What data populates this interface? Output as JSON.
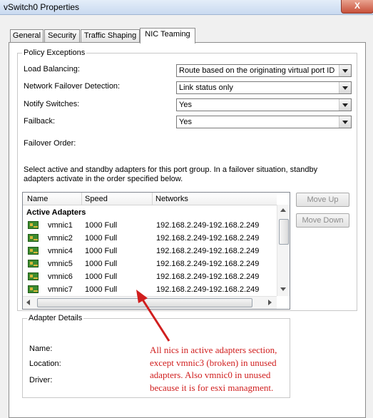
{
  "window": {
    "title": "vSwitch0 Properties",
    "close_label": "X"
  },
  "tabs": [
    "General",
    "Security",
    "Traffic Shaping",
    "NIC Teaming"
  ],
  "policy": {
    "legend": "Policy Exceptions",
    "rows": [
      {
        "label": "Load Balancing:",
        "value": "Route based on the originating virtual port ID"
      },
      {
        "label": "Network Failover Detection:",
        "value": "Link status only"
      },
      {
        "label": "Notify Switches:",
        "value": "Yes"
      },
      {
        "label": "Failback:",
        "value": "Yes"
      }
    ],
    "failover_order_label": "Failover Order:",
    "description": "Select active and standby adapters for this port group.  In a failover situation, standby adapters activate  in the order specified below."
  },
  "adapters": {
    "columns": [
      "Name",
      "Speed",
      "Networks"
    ],
    "group": "Active Adapters",
    "rows": [
      {
        "name": "vmnic1",
        "speed": "1000 Full",
        "networks": "192.168.2.249-192.168.2.249"
      },
      {
        "name": "vmnic2",
        "speed": "1000 Full",
        "networks": "192.168.2.249-192.168.2.249"
      },
      {
        "name": "vmnic4",
        "speed": "1000 Full",
        "networks": "192.168.2.249-192.168.2.249"
      },
      {
        "name": "vmnic5",
        "speed": "1000 Full",
        "networks": "192.168.2.249-192.168.2.249"
      },
      {
        "name": "vmnic6",
        "speed": "1000 Full",
        "networks": "192.168.2.249-192.168.2.249"
      },
      {
        "name": "vmnic7",
        "speed": "1000 Full",
        "networks": "192.168.2.249-192.168.2.249"
      }
    ]
  },
  "buttons": {
    "move_up": "Move Up",
    "move_down": "Move Down"
  },
  "details": {
    "legend": "Adapter Details",
    "name": "Name:",
    "location": "Location:",
    "driver": "Driver:"
  },
  "annotation": {
    "lines": [
      "All nics in active adapters section,",
      "except vmnic3 (broken) in unused",
      "adapters. Also vmnic0 in unused",
      "because it is for esxi managment."
    ],
    "color": "#d01e1e"
  }
}
